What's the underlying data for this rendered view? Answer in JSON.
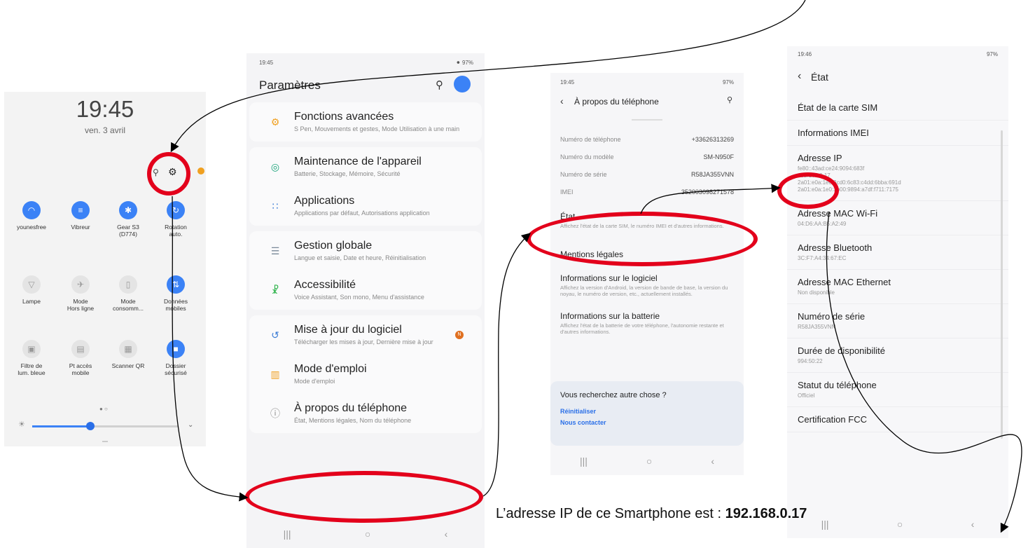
{
  "panel1": {
    "time": "19:45",
    "date": "ven. 3 avril",
    "tiles": [
      {
        "label": "younesfree",
        "icon": "wifi-icon",
        "on": true
      },
      {
        "label": "Vibreur",
        "icon": "vibrate-icon",
        "on": true
      },
      {
        "label": "Gear S3\n(D774)",
        "icon": "bluetooth-icon",
        "on": true
      },
      {
        "label": "Rotation\nauto.",
        "icon": "rotation-icon",
        "on": true
      },
      {
        "label": "Lampe",
        "icon": "flashlight-icon",
        "on": false
      },
      {
        "label": "Mode\nHors ligne",
        "icon": "airplane-icon",
        "on": false
      },
      {
        "label": "Mode\nconsomm...",
        "icon": "battery-icon",
        "on": false
      },
      {
        "label": "Données\nmobiles",
        "icon": "mobile-data-icon",
        "on": true
      },
      {
        "label": "Filtre de\nlum. bleue",
        "icon": "blue-filter-icon",
        "on": false
      },
      {
        "label": "Pt accès\nmobile",
        "icon": "hotspot-icon",
        "on": false
      },
      {
        "label": "Scanner QR",
        "icon": "qr-icon",
        "on": false
      },
      {
        "label": "Dossier\nsécurisé",
        "icon": "secure-folder-icon",
        "on": true
      }
    ],
    "brightness": 0.4
  },
  "panel2": {
    "status_time": "19:45",
    "status_right": "97%",
    "title": "Paramètres",
    "groups": [
      [
        {
          "title": "Fonctions avancées",
          "sub": "S Pen, Mouvements et gestes, Mode Utilisation à une main",
          "icon": "gear-icon",
          "color": "#f0a020"
        }
      ],
      [
        {
          "title": "Maintenance de l'appareil",
          "sub": "Batterie, Stockage, Mémoire, Sécurité",
          "icon": "maintenance-icon",
          "color": "#1aa37a"
        },
        {
          "title": "Applications",
          "sub": "Applications par défaut, Autorisations application",
          "icon": "apps-icon",
          "color": "#3a7bd5"
        }
      ],
      [
        {
          "title": "Gestion globale",
          "sub": "Langue et saisie, Date et heure, Réinitialisation",
          "icon": "sliders-icon",
          "color": "#7a8a99"
        },
        {
          "title": "Accessibilité",
          "sub": "Voice Assistant, Son mono, Menu d'assistance",
          "icon": "accessibility-icon",
          "color": "#2db34a"
        }
      ],
      [
        {
          "title": "Mise à jour du logiciel",
          "sub": "Télécharger les mises à jour, Dernière mise à jour",
          "icon": "update-icon",
          "color": "#3a7bd5"
        },
        {
          "title": "Mode d'emploi",
          "sub": "Mode d'emploi",
          "icon": "manual-icon",
          "color": "#f0a020"
        },
        {
          "title": "À propos du téléphone",
          "sub": "État, Mentions légales, Nom du téléphone",
          "icon": "info-icon",
          "color": "#8a8a8a"
        }
      ]
    ],
    "update_badge": "N"
  },
  "panel3": {
    "status_time": "19:45",
    "status_right": "97%",
    "title": "À propos du téléphone",
    "info": [
      {
        "k": "Numéro de téléphone",
        "v": "+33626313269"
      },
      {
        "k": "Numéro du modèle",
        "v": "SM-N950F"
      },
      {
        "k": "Numéro de série",
        "v": "R58JA355VNN"
      },
      {
        "k": "IMEI",
        "v": "352003098271578"
      }
    ],
    "items": [
      {
        "title": "État",
        "sub": "Affichez l'état de la carte SIM, le numéro IMEI et d'autres informations."
      },
      {
        "title": "Mentions légales",
        "sub": ""
      },
      {
        "title": "Informations sur le logiciel",
        "sub": "Affichez la version d'Android, la version de bande de base, la version du noyau, le numéro de version, etc., actuellement installés."
      },
      {
        "title": "Informations sur la batterie",
        "sub": "Affichez l'état de la batterie de votre téléphone, l'autonomie restante et d'autres informations."
      }
    ],
    "search_box": {
      "title": "Vous recherchez autre chose ?",
      "link1": "Réinitialiser",
      "link2": "Nous contacter"
    }
  },
  "panel4": {
    "status_time": "19:46",
    "status_right": "97%",
    "title": "État",
    "rows": [
      {
        "title": "État de la carte SIM",
        "sub": ""
      },
      {
        "title": "Informations IMEI",
        "sub": ""
      },
      {
        "title": "Adresse IP",
        "sub": "fe80::43ad:ce24:9094:683f\n192.168.0.17\n2a01:e0a:1e0:3cd0:6c83:c4dd:6bba:691d\n2a01:e0a:1e0:3b00:9894:a7df:f711:7175"
      },
      {
        "title": "Adresse MAC Wi-Fi",
        "sub": "04:D6:AA:B5:A2:49"
      },
      {
        "title": "Adresse Bluetooth",
        "sub": "3C:F7:A4:34:67:EC"
      },
      {
        "title": "Adresse MAC Ethernet",
        "sub": "Non disponible"
      },
      {
        "title": "Numéro de série",
        "sub": "R58JA355VNN"
      },
      {
        "title": "Durée de disponibilité",
        "sub": "994:50:22"
      },
      {
        "title": "Statut du téléphone",
        "sub": "Officiel"
      },
      {
        "title": "Certification FCC",
        "sub": ""
      }
    ]
  },
  "caption": {
    "text": "L’adresse IP de ce Smartphone est : ",
    "ip": "192.168.0.17"
  },
  "colors": {
    "accent": "#3b82f6",
    "highlight": "#e3001b"
  }
}
